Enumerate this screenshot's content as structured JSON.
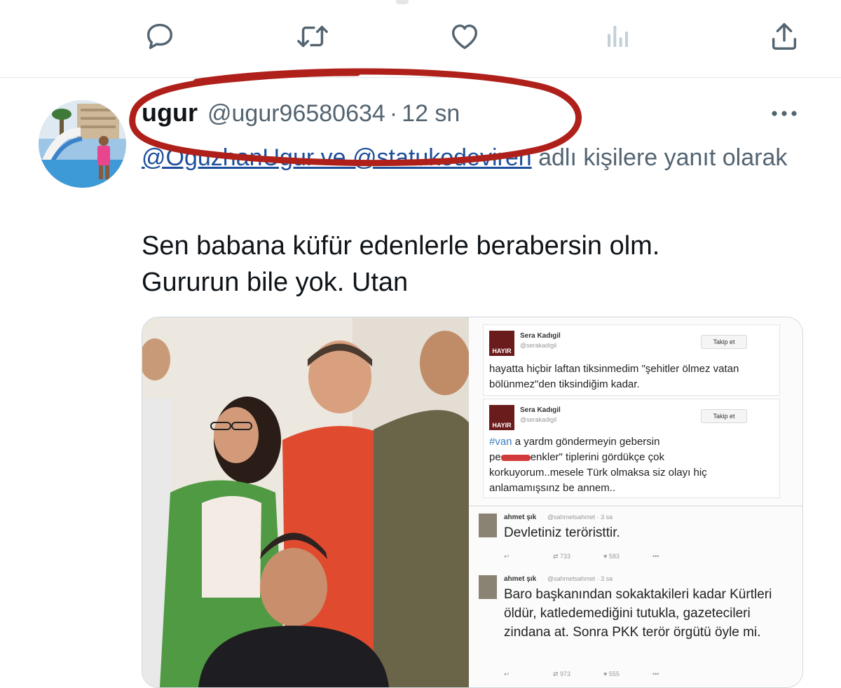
{
  "actions": {
    "reply_icon": "reply-icon",
    "retweet_icon": "retweet-icon",
    "like_icon": "like-icon",
    "analytics_icon": "analytics-icon",
    "share_icon": "share-icon"
  },
  "tweet": {
    "author_name": "ugur",
    "author_handle": "@ugur96580634",
    "separator": "·",
    "time": "12 sn",
    "replying_mentions": "@OguzhanUgur ve @statukodeviren",
    "replying_suffix": " adlı kişilere yanıt olarak",
    "text_line1": "Sen babana küfür edenlerle berabersin olm.",
    "text_line2": "Gururun bile yok. Utan"
  },
  "embedded": {
    "post1": {
      "name": "Sera Kadıgil",
      "handle": "@serakadigil",
      "avatar_text": "HAYIR",
      "follow": "Takip et",
      "text": "hayatta hiçbir laftan tiksinmedim \"şehitler ölmez vatan bölünmez\"den tiksindiğim kadar."
    },
    "post2": {
      "name": "Sera Kadıgil",
      "handle": "@serakadigil",
      "avatar_text": "HAYIR",
      "follow": "Takip et",
      "hashtag": "#van",
      "text_a": " a yardm göndermeyin gebersin",
      "text_b_prefix": "pe",
      "text_b_suffix": "enkler\" tiplerini gördükçe çok",
      "text_c": "korkuyorum..mesele Türk olmaksa siz olayı hiç anlamamışsınz be annem.."
    },
    "post3": {
      "name": "ahmet şık",
      "handle": "@sahmetsahmet · 3 sa",
      "text": "Devletiniz teröristtir.",
      "retweets": "733",
      "likes": "583"
    },
    "post4": {
      "name": "ahmet şık",
      "handle": "@sahmetsahmet · 3 sa",
      "text": "Baro başkanından sokaktakileri kadar Kürtleri öldür, katledemediğini tutukla, gazetecileri zindana at. Sonra PKK terör örgütü öyle mi.",
      "retweets": "973",
      "likes": "555"
    }
  },
  "colors": {
    "annotation_red": "#b0201a",
    "link_blue": "#1d4f9b",
    "secondary_text": "#536471"
  }
}
